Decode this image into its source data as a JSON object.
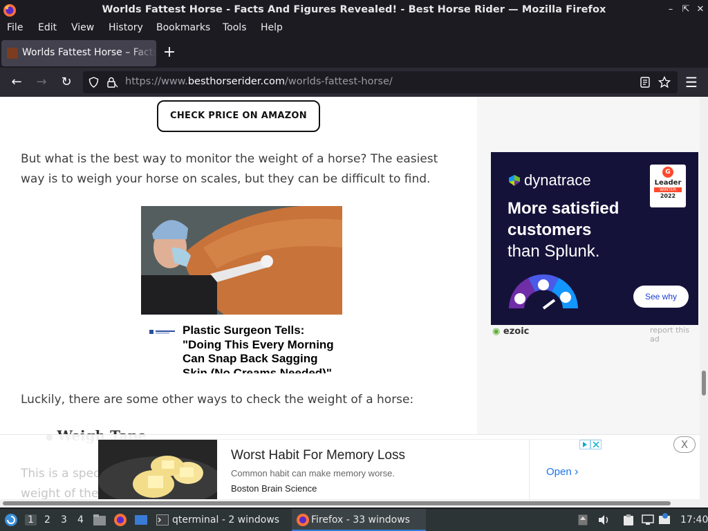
{
  "window": {
    "title": "Worlds Fattest Horse - Facts And Figures Revealed! - Best Horse Rider — Mozilla Firefox"
  },
  "menubar": [
    "File",
    "Edit",
    "View",
    "History",
    "Bookmarks",
    "Tools",
    "Help"
  ],
  "tab": {
    "label": "Worlds Fattest Horse – Facts"
  },
  "navbar": {
    "url_scheme": "https://www.",
    "url_host": "besthorserider.com",
    "url_path": "/worlds-fattest-horse/"
  },
  "article": {
    "amazon_button": "CHECK PRICE ON AMAZON",
    "paragraph1": "But what is the best way to monitor the weight of a horse? The easiest way is to weigh your horse on scales, but they can be difficult to find.",
    "paragraph2": "Luckily, there are some other ways to check the weight of a horse:",
    "list_item1": "Weigh Tape",
    "paragraph3_partial": "This is a spec",
    "paragraph3_partial2": "weight of the"
  },
  "native_ad": {
    "headline": "Plastic Surgeon Tells: \"Doing This Every Morning Can Snap Back Sagging Skin (No Creams Needed)\""
  },
  "sidebar_ad": {
    "brand": "dynatrace",
    "line1": "More satisfied",
    "line2": "customers",
    "line3": "than Splunk.",
    "badge_top": "G",
    "badge_title": "Leader",
    "badge_season": "WINTER",
    "badge_year": "2022",
    "cta": "See why",
    "ezoic": "ezoic",
    "report": "report this ad"
  },
  "sticky_ad": {
    "title": "Worst Habit For Memory Loss",
    "description": "Common habit can make memory worse.",
    "source": "Boston Brain Science",
    "cta": "Open",
    "close": "X"
  },
  "taskbar": {
    "workspaces": [
      "1",
      "2",
      "3",
      "4"
    ],
    "task1": "qterminal - 2 windows",
    "task2": "Firefox - 33 windows",
    "clock": "17:40"
  }
}
